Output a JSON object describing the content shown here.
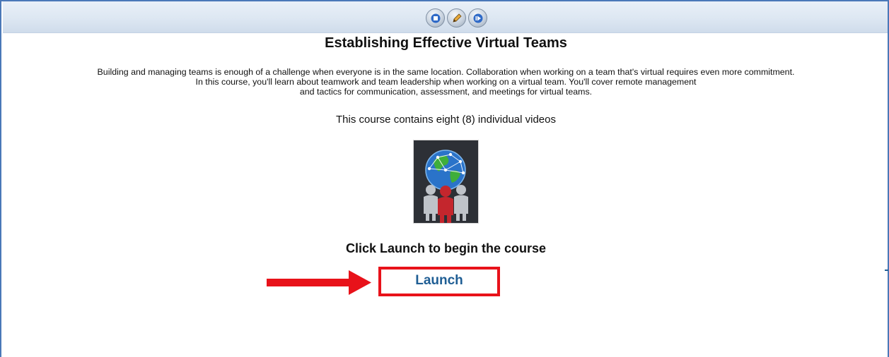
{
  "toolbar": {
    "buttons": [
      {
        "icon": "stop-icon"
      },
      {
        "icon": "pencil-icon"
      },
      {
        "icon": "play-icon"
      }
    ]
  },
  "course": {
    "title": "Establishing Effective Virtual Teams",
    "description_lines": [
      "Building and managing teams is enough of a challenge when everyone is in the same location. Collaboration when working on a team that's virtual requires even more commitment.",
      "In this course, you'll learn about teamwork and team leadership when working on a virtual team. You'll cover remote management",
      "and tactics for communication, assessment, and meetings for virtual teams."
    ],
    "video_count_text": "This course contains eight (8) individual videos",
    "thumbnail_icon": "global-team-icon",
    "cta_text": "Click Launch to begin the course",
    "launch_label": "Launch"
  },
  "colors": {
    "highlight_red": "#e8121a",
    "link_blue": "#1f5e94",
    "frame_blue": "#4a78b8"
  }
}
